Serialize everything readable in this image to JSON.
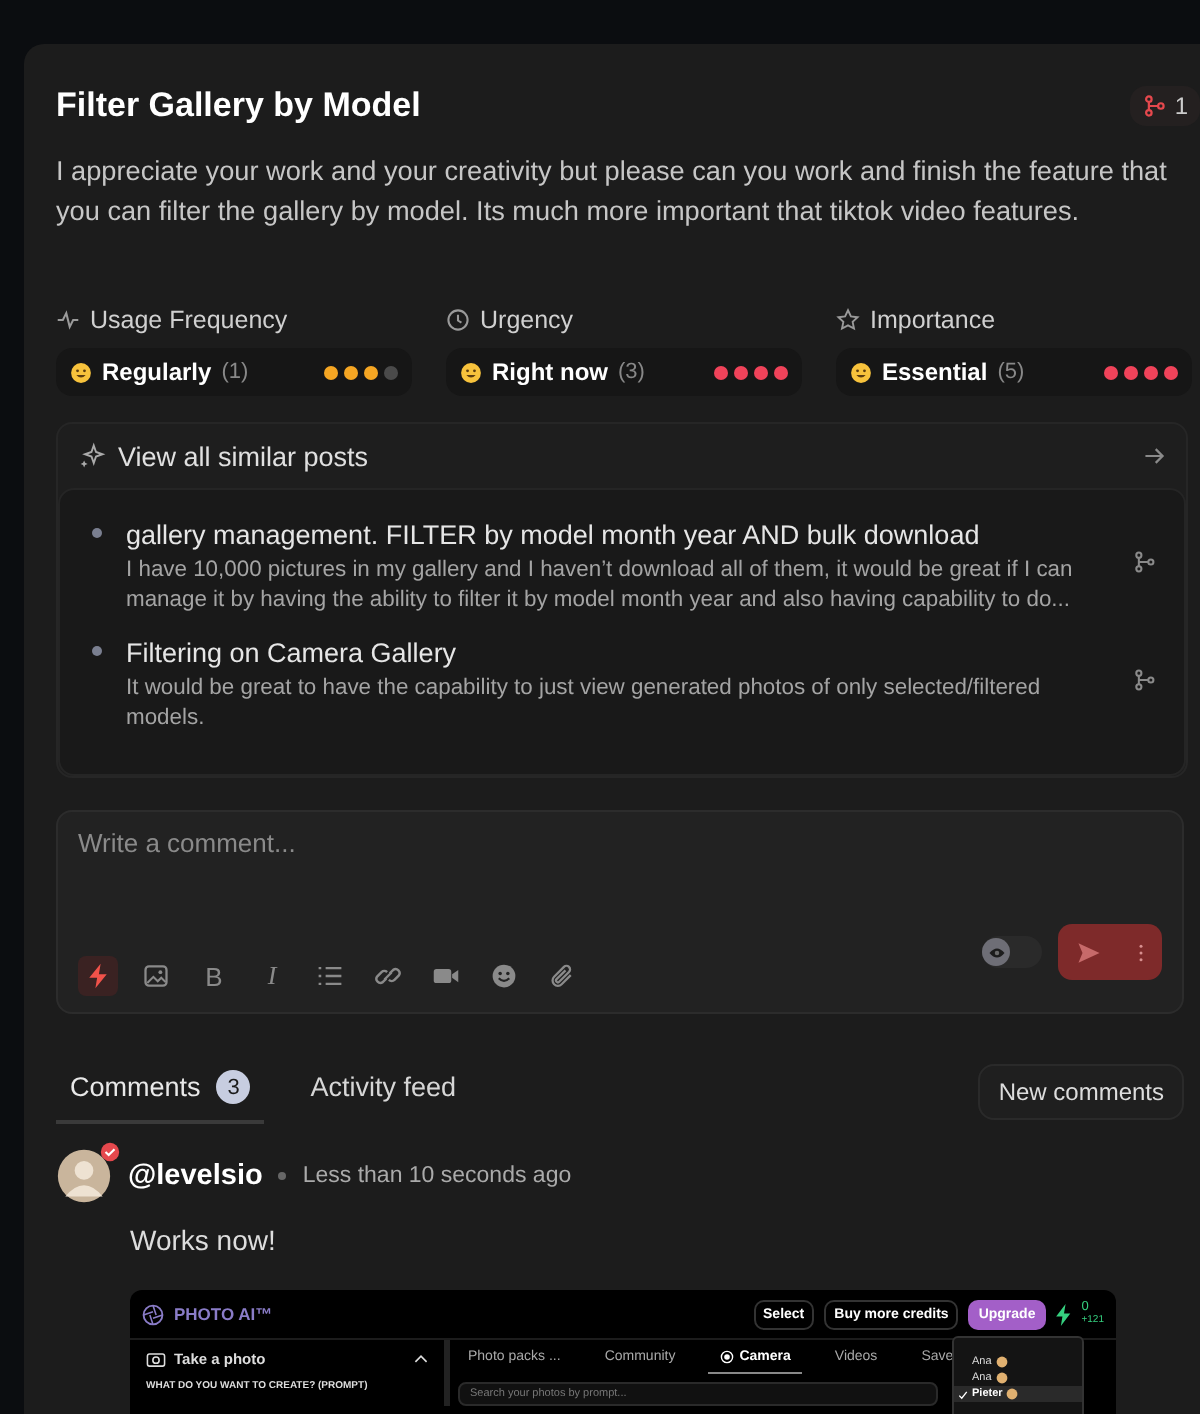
{
  "post": {
    "title": "Filter Gallery by Model",
    "description": "I appreciate your work and your creativity but please can you work and finish the feature that you can filter the gallery by model. Its much more important that tiktok video features.",
    "vote_count": "1"
  },
  "ratings": [
    {
      "kind": "frequency",
      "label": "Usage Frequency",
      "value": "Regularly",
      "count": "(1)",
      "stars": 3,
      "color": "#f5a623"
    },
    {
      "kind": "urgency",
      "label": "Urgency",
      "value": "Right now",
      "count": "(3)",
      "stars": 4,
      "color": "#f0435a"
    },
    {
      "kind": "importance",
      "label": "Importance",
      "value": "Essential",
      "count": "(5)",
      "stars": 4,
      "color": "#f0435a"
    }
  ],
  "similar_posts": {
    "header": "View all similar posts",
    "items": [
      {
        "title": "gallery management. FILTER by model month year AND bulk download",
        "excerpt": "I have 10,000 pictures in my gallery and I haven’t download all of them, it would be great if I can manage it by having the ability to filter it by model month year and also having capability to do..."
      },
      {
        "title": "Filtering on Camera Gallery",
        "excerpt": "It would be great to have the capability to just view generated photos of only selected/filtered models."
      }
    ]
  },
  "comment_box": {
    "placeholder": "Write a comment...",
    "toolbar": [
      {
        "kind": "bolt",
        "selected": true
      },
      {
        "kind": "image",
        "selected": false
      },
      {
        "kind": "bold",
        "label": "B",
        "selected": false
      },
      {
        "kind": "italic",
        "label": "I",
        "selected": false
      },
      {
        "kind": "list",
        "selected": false
      },
      {
        "kind": "link",
        "selected": false
      },
      {
        "kind": "video",
        "selected": false
      },
      {
        "kind": "emoji",
        "selected": false
      },
      {
        "kind": "attach",
        "selected": false
      }
    ],
    "private_toggle": {
      "on": false
    }
  },
  "tabs": [
    {
      "label": "Comments",
      "badge": "3",
      "selected": true
    },
    {
      "label": "Activity feed",
      "selected": false
    }
  ],
  "new_comments_button": "New comments",
  "comments": [
    {
      "author": "@levelsio",
      "verified": true,
      "time": "Less than 10 seconds ago",
      "text": "Works now!",
      "attachment": {
        "logo": "PHOTO AI™",
        "buttons": [
          "Select",
          "Buy more credits"
        ],
        "upgrade": "Upgrade",
        "credits": "0",
        "credits_sub": "+121",
        "panel_title": "Take a photo",
        "prompt_label": "WHAT DO YOU WANT TO CREATE? (PROMPT)",
        "tabs": [
          {
            "label": "Photo packs ...",
            "selected": false
          },
          {
            "label": "Community",
            "selected": false
          },
          {
            "label": "Camera",
            "selected": true
          },
          {
            "label": "Videos",
            "selected": false
          },
          {
            "label": "Save",
            "selected": false
          }
        ],
        "search_placeholder": "Search your photos by prompt...",
        "model_menu": [
          {
            "label": "Ana",
            "selected": false
          },
          {
            "label": "Ana",
            "selected": false
          },
          {
            "label": "Pieter",
            "selected": true
          }
        ]
      }
    }
  ]
}
